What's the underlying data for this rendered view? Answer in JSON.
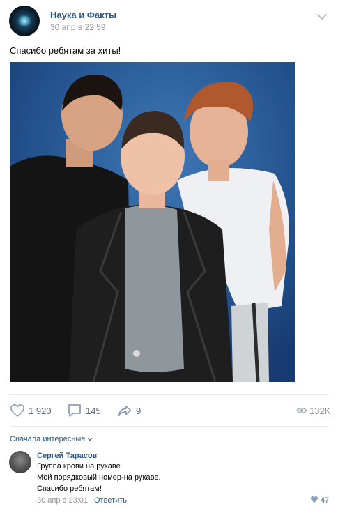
{
  "post": {
    "group_name": "Наука и Факты",
    "date": "30 апр в 22:59",
    "text": "Спасибо ребятам за хиты!",
    "photo_icon": "group-photo"
  },
  "actions": {
    "likes": "1 920",
    "comments": "145",
    "shares": "9",
    "views": "132K",
    "like_icon": "heart-icon",
    "comment_icon": "comment-icon",
    "share_icon": "share-arrow-icon",
    "views_icon": "eye-icon"
  },
  "comments_sort": "Сначала интересные",
  "comment": {
    "author": "Сергей Тарасов",
    "lines": [
      "Группа крови на рукаве",
      "Мой порядковый номер-на рукаве.",
      "Спасибо ребятам!"
    ],
    "date": "30 апр в 23:01",
    "reply_label": "Ответить",
    "likes": "47"
  },
  "colors": {
    "link": "#2a5885",
    "muted": "#939393",
    "icon": "#8aa0b9",
    "photo_bg": "#1f4d8a"
  }
}
